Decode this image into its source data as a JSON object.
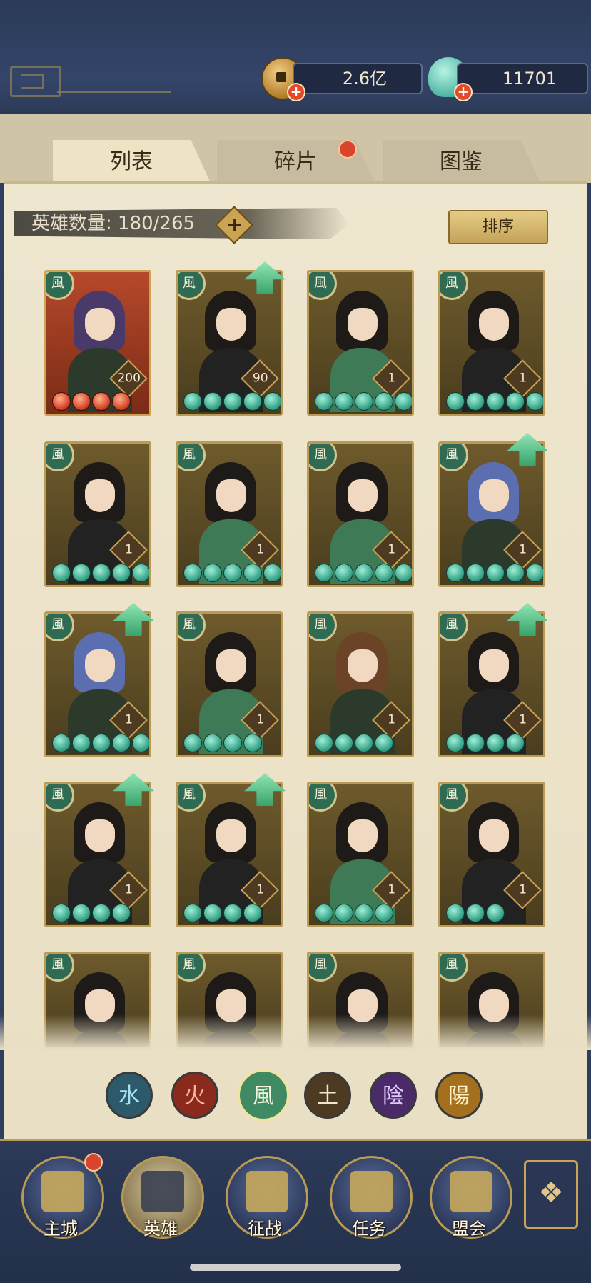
{
  "currencies": {
    "gold": {
      "value": "2.6亿",
      "icon": "copper-coin-icon"
    },
    "jade": {
      "value": "11701",
      "icon": "jade-shell-icon"
    }
  },
  "tabs": [
    {
      "label": "列表",
      "active": true
    },
    {
      "label": "碎片",
      "active": false,
      "has_notice": true
    },
    {
      "label": "图鉴",
      "active": false
    }
  ],
  "hero_count": {
    "label": "英雄数量: 180/265"
  },
  "sort_button": {
    "label": "排序"
  },
  "element_badge_text": "風",
  "heroes": [
    {
      "level": "200",
      "stars": 4,
      "star_color": "red",
      "upgrade": false
    },
    {
      "level": "90",
      "stars": 5,
      "star_color": "green",
      "upgrade": true
    },
    {
      "level": "1",
      "stars": 5,
      "star_color": "green",
      "upgrade": false
    },
    {
      "level": "1",
      "stars": 5,
      "star_color": "green",
      "upgrade": false
    },
    {
      "level": "1",
      "stars": 5,
      "star_color": "green",
      "upgrade": false
    },
    {
      "level": "1",
      "stars": 5,
      "star_color": "green",
      "upgrade": false
    },
    {
      "level": "1",
      "stars": 5,
      "star_color": "green",
      "upgrade": false
    },
    {
      "level": "1",
      "stars": 5,
      "star_color": "green",
      "upgrade": true
    },
    {
      "level": "1",
      "stars": 5,
      "star_color": "green",
      "upgrade": true
    },
    {
      "level": "1",
      "stars": 4,
      "star_color": "green",
      "upgrade": false
    },
    {
      "level": "1",
      "stars": 4,
      "star_color": "green",
      "upgrade": false
    },
    {
      "level": "1",
      "stars": 4,
      "star_color": "green",
      "upgrade": true
    },
    {
      "level": "1",
      "stars": 4,
      "star_color": "green",
      "upgrade": true
    },
    {
      "level": "1",
      "stars": 4,
      "star_color": "green",
      "upgrade": true
    },
    {
      "level": "1",
      "stars": 4,
      "star_color": "green",
      "upgrade": false
    },
    {
      "level": "1",
      "stars": 3,
      "star_color": "green",
      "upgrade": false
    },
    {
      "level": "",
      "stars": 0,
      "star_color": "green",
      "upgrade": false
    },
    {
      "level": "",
      "stars": 0,
      "star_color": "green",
      "upgrade": false
    },
    {
      "level": "",
      "stars": 0,
      "star_color": "green",
      "upgrade": false
    },
    {
      "level": "",
      "stars": 0,
      "star_color": "green",
      "upgrade": false
    }
  ],
  "element_filters": [
    {
      "key": "water",
      "glyph": "水"
    },
    {
      "key": "fire",
      "glyph": "火"
    },
    {
      "key": "wind",
      "glyph": "風",
      "selected": true
    },
    {
      "key": "earth",
      "glyph": "土"
    },
    {
      "key": "yin",
      "glyph": "陰"
    },
    {
      "key": "yang",
      "glyph": "陽"
    }
  ],
  "bottom_nav": [
    {
      "label": "主城",
      "icon": "main-city-icon",
      "has_notice": true
    },
    {
      "label": "英雄",
      "icon": "hero-icon",
      "active": true
    },
    {
      "label": "征战",
      "icon": "campaign-icon"
    },
    {
      "label": "任务",
      "icon": "quest-icon"
    },
    {
      "label": "盟会",
      "icon": "guild-icon"
    }
  ],
  "more_button": {
    "icon": "more-menu-icon"
  }
}
